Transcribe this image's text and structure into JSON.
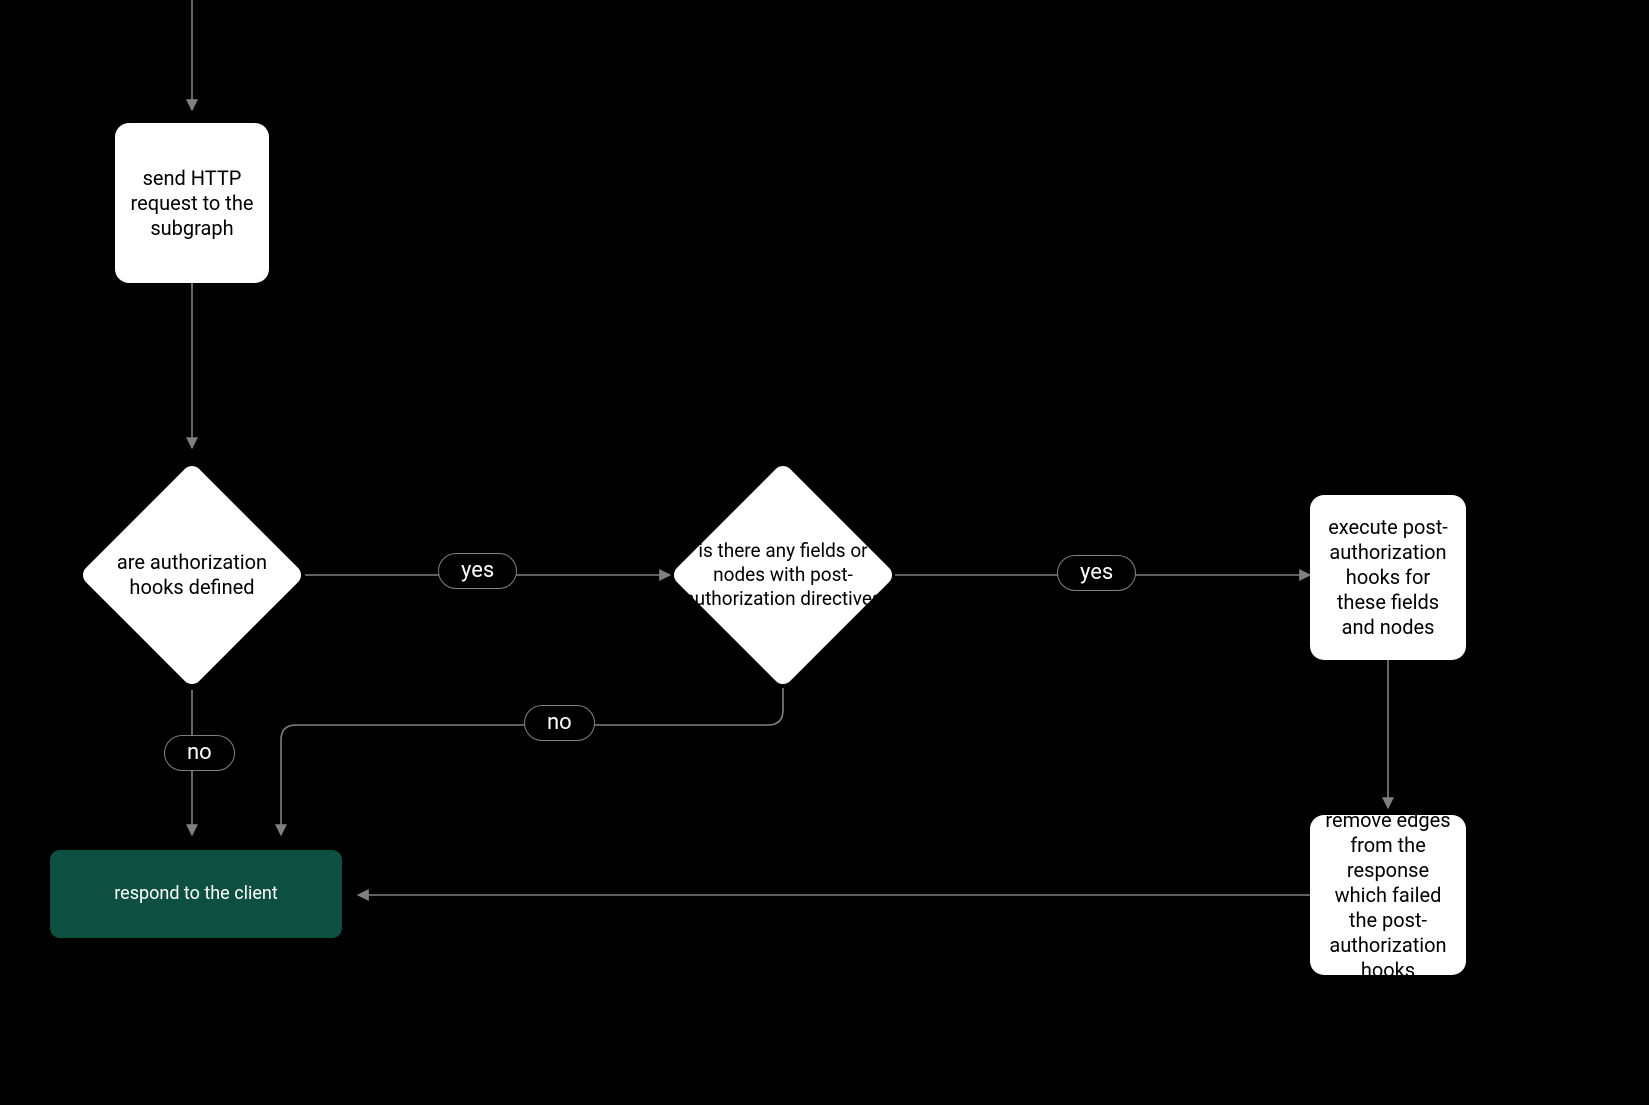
{
  "nodes": {
    "send_http": "send HTTP request to the subgraph",
    "auth_hooks_defined": "are authorization hooks defined",
    "post_auth_fields": "is there any fields or nodes with post-authorization directives",
    "execute_post_auth": "execute post-authorization hooks for these fields and nodes",
    "remove_edges": "remove edges from the response which failed the post-authorization hooks",
    "respond_client": "respond to the client"
  },
  "edges": {
    "yes1": "yes",
    "yes2": "yes",
    "no1": "no",
    "no2": "no"
  },
  "colors": {
    "node_bg": "#ffffff",
    "terminal_bg": "#0d4f40",
    "edge": "#808080",
    "canvas": "#000000"
  }
}
